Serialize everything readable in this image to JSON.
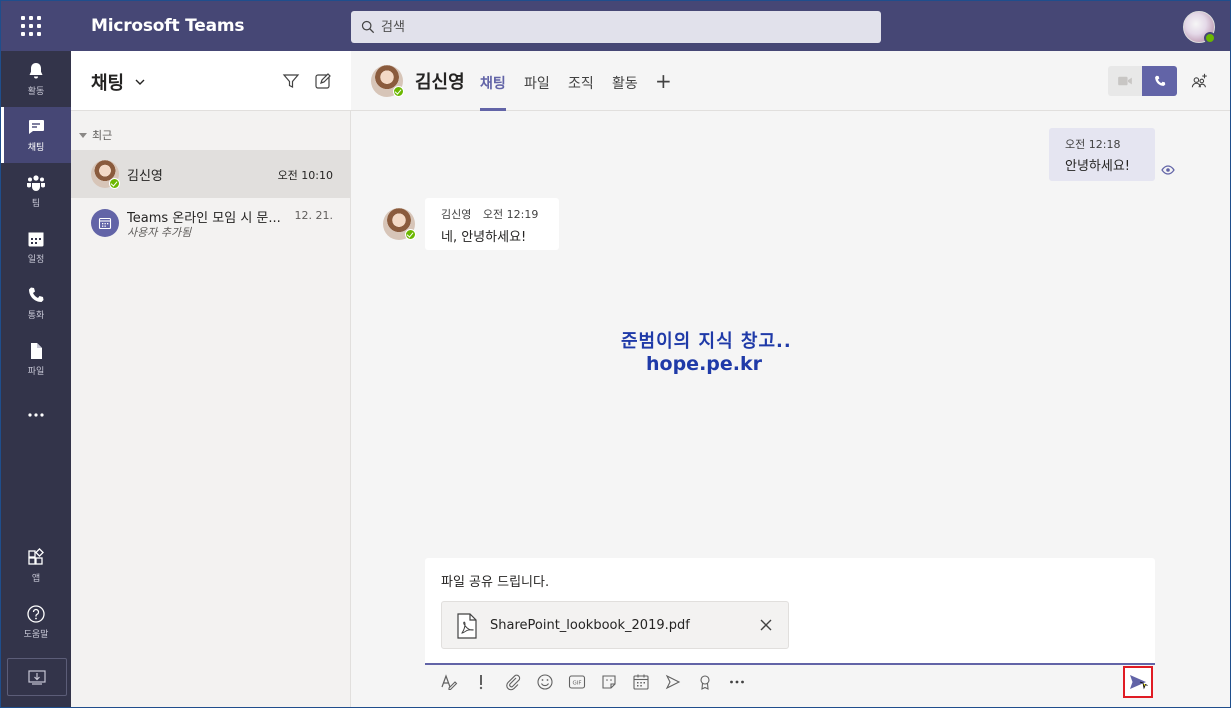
{
  "app": {
    "title": "Microsoft Teams"
  },
  "search": {
    "placeholder": "검색"
  },
  "rail": {
    "items": [
      {
        "label": "활동",
        "icon": "bell-icon"
      },
      {
        "label": "채팅",
        "icon": "chat-icon"
      },
      {
        "label": "팀",
        "icon": "teams-icon"
      },
      {
        "label": "일정",
        "icon": "calendar-icon"
      },
      {
        "label": "통화",
        "icon": "phone-icon"
      },
      {
        "label": "파일",
        "icon": "file-icon"
      }
    ],
    "apps_label": "앱",
    "help_label": "도움말"
  },
  "chat_list": {
    "title": "채팅",
    "section": "최근",
    "rows": [
      {
        "name": "김신영",
        "time": "오전 10:10"
      },
      {
        "name": "Teams 온라인 모임 시 문...",
        "sub": "사용자 추가됨",
        "time": "12. 21."
      }
    ]
  },
  "conversation": {
    "name": "김신영",
    "tabs": [
      "채팅",
      "파일",
      "조직",
      "활동"
    ],
    "messages": [
      {
        "from": "me",
        "time": "오전 12:18",
        "text": "안녕하세요!"
      },
      {
        "from": "김신영",
        "time": "오전 12:19",
        "text": "네, 안녕하세요!"
      }
    ]
  },
  "watermark": {
    "line1": "준범이의 지식 창고..",
    "line2": "hope.pe.kr"
  },
  "compose": {
    "text": "파일 공유 드립니다.",
    "attachment": "SharePoint_lookbook_2019.pdf"
  },
  "colors": {
    "brand": "#6264a7",
    "topbar": "#464775",
    "rail": "#33344a",
    "presence": "#6bb700",
    "highlight": "#e01c24"
  }
}
